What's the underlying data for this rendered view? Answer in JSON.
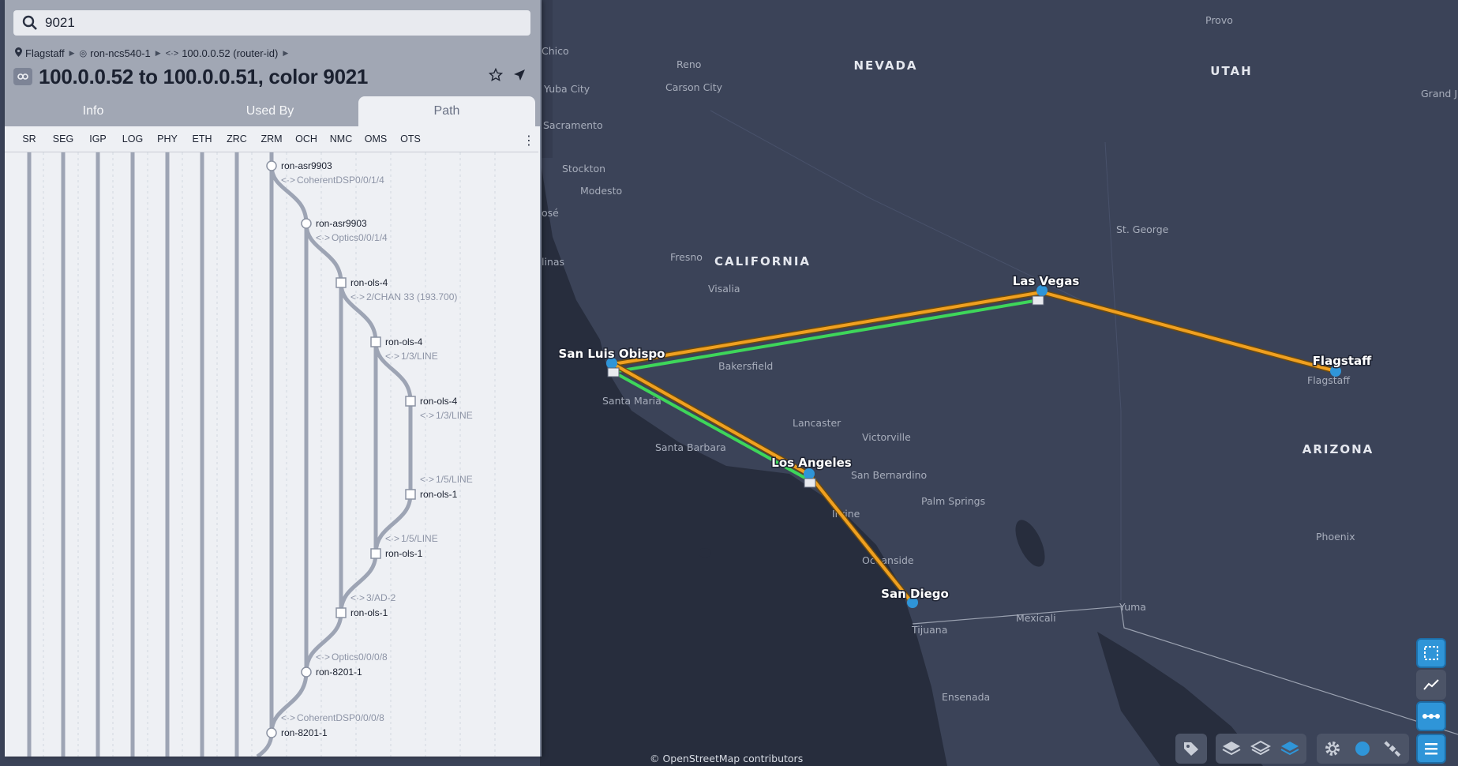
{
  "search": {
    "value": "9021"
  },
  "breadcrumb": {
    "site": "Flagstaff",
    "device": "ron-ncs540-1",
    "interface": "100.0.0.52 (router-id)"
  },
  "title": "100.0.0.52 to 100.0.0.51, color 9021",
  "tabs": [
    {
      "label": "Info"
    },
    {
      "label": "Used By"
    },
    {
      "label": "Path",
      "active": true
    }
  ],
  "layers": [
    "SR",
    "SEG",
    "IGP",
    "LOG",
    "PHY",
    "ETH",
    "ZRC",
    "ZRM",
    "OCH",
    "NMC",
    "OMS",
    "OTS"
  ],
  "path": [
    {
      "node": "ron-asr9903",
      "iface": "CoherentDSP0/0/1/4"
    },
    {
      "node": "ron-asr9903",
      "iface": "Optics0/0/1/4"
    },
    {
      "node": "ron-ols-4",
      "iface": "2/CHAN 33 (193.700)"
    },
    {
      "node": "ron-ols-4",
      "iface": "1/3/LINE"
    },
    {
      "node": "ron-ols-4",
      "iface": "1/3/LINE"
    },
    {
      "node": "ron-ols-1",
      "iface": "1/5/LINE"
    },
    {
      "node": "ron-ols-1",
      "iface": "1/5/LINE"
    },
    {
      "node": "ron-ols-1",
      "iface": "3/AD-2"
    },
    {
      "node": "ron-8201-1",
      "iface": "Optics0/0/0/8"
    },
    {
      "node": "ron-8201-1",
      "iface": "CoherentDSP0/0/0/8"
    }
  ],
  "map": {
    "states": [
      "NEVADA",
      "UTAH",
      "CALIFORNIA",
      "ARIZONA"
    ],
    "cities": [
      "Provo",
      "Grand Ju",
      "Chico",
      "Reno",
      "Carson City",
      "Yuba City",
      "Sacramento",
      "Stockton",
      "Modesto",
      "osé",
      "linas",
      "Fresno",
      "Visalia",
      "St. George",
      "Bakersfield",
      "Santa Maria",
      "Lancaster",
      "Victorville",
      "Santa Barbara",
      "San Bernardino",
      "Palm Springs",
      "Irvine",
      "Oceanside",
      "Phoenix",
      "Mexicali",
      "Yuma",
      "Tijuana",
      "Ensenada",
      "Flagstaff",
      "Las Vegas",
      "San Luis Obispo",
      "Los Angeles",
      "San Diego"
    ],
    "sites": [
      "Las Vegas",
      "San Luis Obispo",
      "Los Angeles",
      "San Diego",
      "Flagstaff"
    ],
    "attribution": "© OpenStreetMap contributors",
    "colors": {
      "orange": "#f0a020",
      "green": "#3ed65a",
      "node": "#2f95d8"
    }
  }
}
